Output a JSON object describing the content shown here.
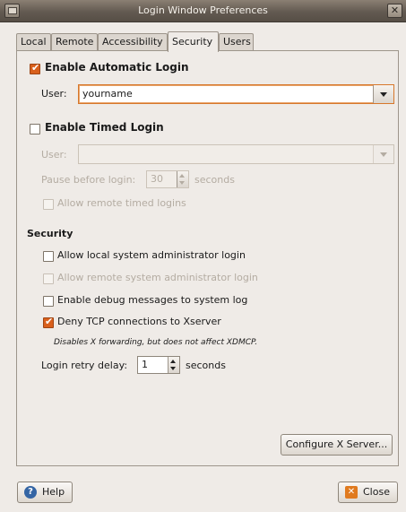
{
  "window": {
    "title": "Login Window Preferences"
  },
  "tabs": [
    {
      "label": "Local"
    },
    {
      "label": "Remote"
    },
    {
      "label": "Accessibility"
    },
    {
      "label": "Security",
      "active": true
    },
    {
      "label": "Users"
    }
  ],
  "auto_login": {
    "label": "Enable Automatic Login",
    "checked": true,
    "user_label": "User:",
    "user_value": "yourname"
  },
  "timed_login": {
    "label": "Enable Timed Login",
    "checked": false,
    "user_label": "User:",
    "user_value": "",
    "pause_label": "Pause before login:",
    "pause_value": "30",
    "pause_unit": "seconds",
    "allow_remote_label": "Allow remote timed logins"
  },
  "security": {
    "heading": "Security",
    "allow_local_admin": "Allow local system administrator login",
    "allow_remote_admin": "Allow remote system administrator login",
    "debug_messages": "Enable debug messages to system log",
    "deny_tcp": "Deny TCP connections to Xserver",
    "deny_tcp_note": "Disables X forwarding, but does not affect XDMCP.",
    "retry_label": "Login retry delay:",
    "retry_value": "1",
    "retry_unit": "seconds"
  },
  "buttons": {
    "configure": "Configure X Server...",
    "help": "Help",
    "close": "Close"
  },
  "colors": {
    "accent": "#d9601c",
    "titlebar": "#635a51"
  }
}
